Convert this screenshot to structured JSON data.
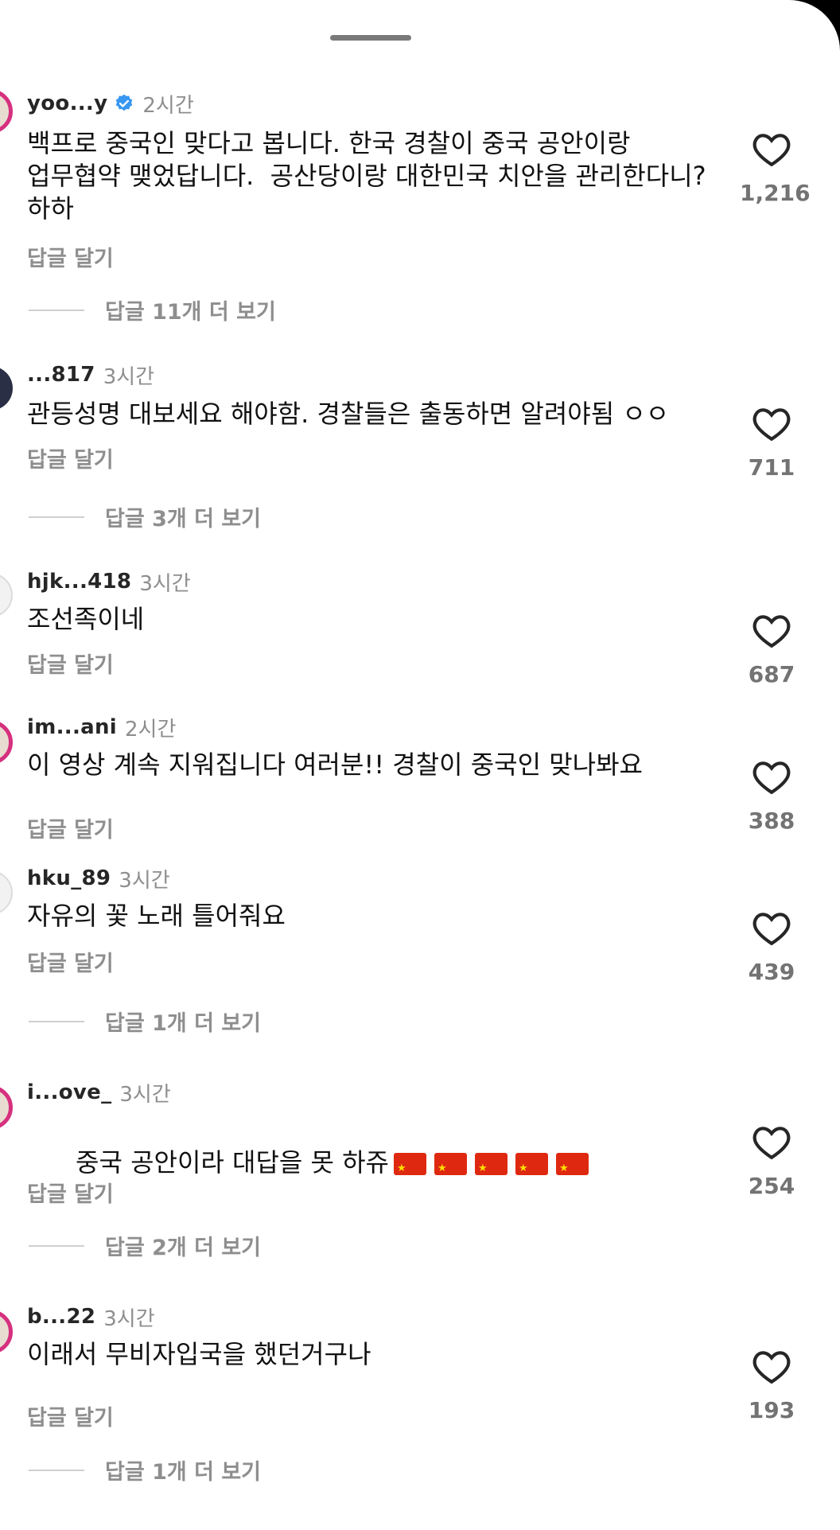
{
  "sheet": {
    "reply_label": "답글 달기"
  },
  "comments": [
    {
      "username": "yoo...y",
      "verified": true,
      "time": "2시간",
      "text": "백프로 중국인 맞다고 봅니다. 한국 경찰이 중국 공안이랑 업무협약 맺었답니다.  공산당이랑 대한민국 치안을 관리한다니? 하하",
      "likes": "1,216",
      "more_replies": "답글 11개 더 보기"
    },
    {
      "username": "...817",
      "verified": false,
      "time": "3시간",
      "text": "관등성명 대보세요 해야함. 경찰들은 출동하면 알려야됨 ㅇㅇ",
      "likes": "711",
      "more_replies": "답글 3개 더 보기"
    },
    {
      "username": "hjk...418",
      "verified": false,
      "time": "3시간",
      "text": "조선족이네",
      "likes": "687",
      "more_replies": ""
    },
    {
      "username": "im...ani",
      "verified": false,
      "time": "2시간",
      "text": "이 영상 계속 지워집니다 여러분!! 경찰이 중국인 맞나봐요",
      "likes": "388",
      "more_replies": ""
    },
    {
      "username": "hku_89",
      "verified": false,
      "time": "3시간",
      "text": "자유의 꽃 노래 틀어줘요",
      "likes": "439",
      "more_replies": "답글 1개 더 보기"
    },
    {
      "username": "i...ove_",
      "verified": false,
      "time": "3시간",
      "text": "중국 공안이라 대답을 못 하쥬",
      "flags": [
        "🇨🇳",
        "🇨🇳",
        "🇨🇳",
        "🇨🇳",
        "🇨🇳"
      ],
      "likes": "254",
      "more_replies": "답글 2개 더 보기"
    },
    {
      "username": "b...22",
      "verified": false,
      "time": "3시간",
      "text": "이래서 무비자입국을 했던거구나",
      "likes": "193",
      "more_replies": "답글 1개 더 보기"
    }
  ],
  "icons": {
    "like": "heart-outline-icon",
    "verified": "verified-badge-icon",
    "flag": "china-flag-icon"
  },
  "colors": {
    "accent_ring": "#d6307f",
    "verified_blue": "#3897f0",
    "secondary_text": "#8e8e8e"
  }
}
